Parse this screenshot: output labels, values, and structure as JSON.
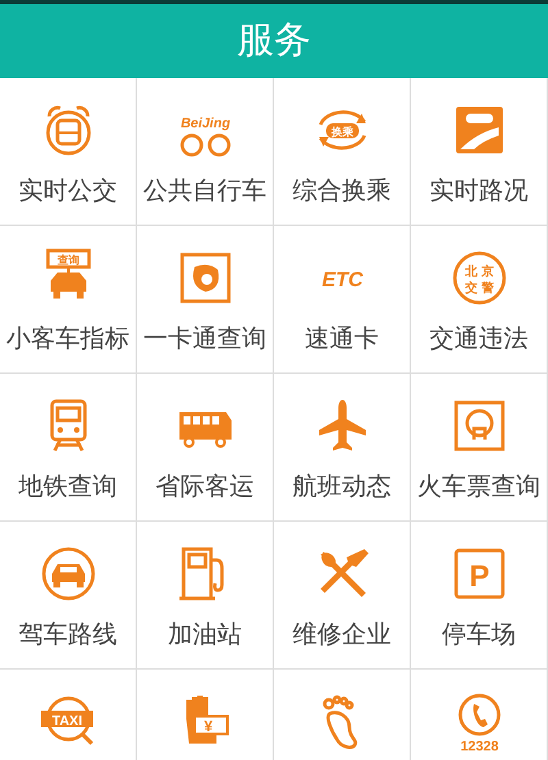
{
  "header": {
    "title": "服务"
  },
  "services": [
    {
      "label": "实时公交",
      "kind": "alarm"
    },
    {
      "label": "公共自行车",
      "kind": "bike",
      "icon_text": "BeiJing"
    },
    {
      "label": "综合换乘",
      "kind": "transfer",
      "icon_text": "换乘"
    },
    {
      "label": "实时路况",
      "kind": "road"
    },
    {
      "label": "小客车指标",
      "kind": "carsign",
      "icon_text": "查询"
    },
    {
      "label": "一卡通查询",
      "kind": "card"
    },
    {
      "label": "速通卡",
      "kind": "etc",
      "icon_text": "ETC"
    },
    {
      "label": "交通违法",
      "kind": "seal",
      "icon_text": "北京交警"
    },
    {
      "label": "地铁查询",
      "kind": "metro"
    },
    {
      "label": "省际客运",
      "kind": "bus"
    },
    {
      "label": "航班动态",
      "kind": "plane"
    },
    {
      "label": "火车票查询",
      "kind": "train"
    },
    {
      "label": "驾车路线",
      "kind": "car"
    },
    {
      "label": "加油站",
      "kind": "fuel"
    },
    {
      "label": "维修企业",
      "kind": "tools"
    },
    {
      "label": "停车场",
      "kind": "parking",
      "icon_text": "P"
    },
    {
      "kind": "taxi",
      "icon_text": "TAXI"
    },
    {
      "kind": "money",
      "icon_text": "¥"
    },
    {
      "kind": "footprint"
    },
    {
      "kind": "phone",
      "icon_text": "12328"
    }
  ]
}
